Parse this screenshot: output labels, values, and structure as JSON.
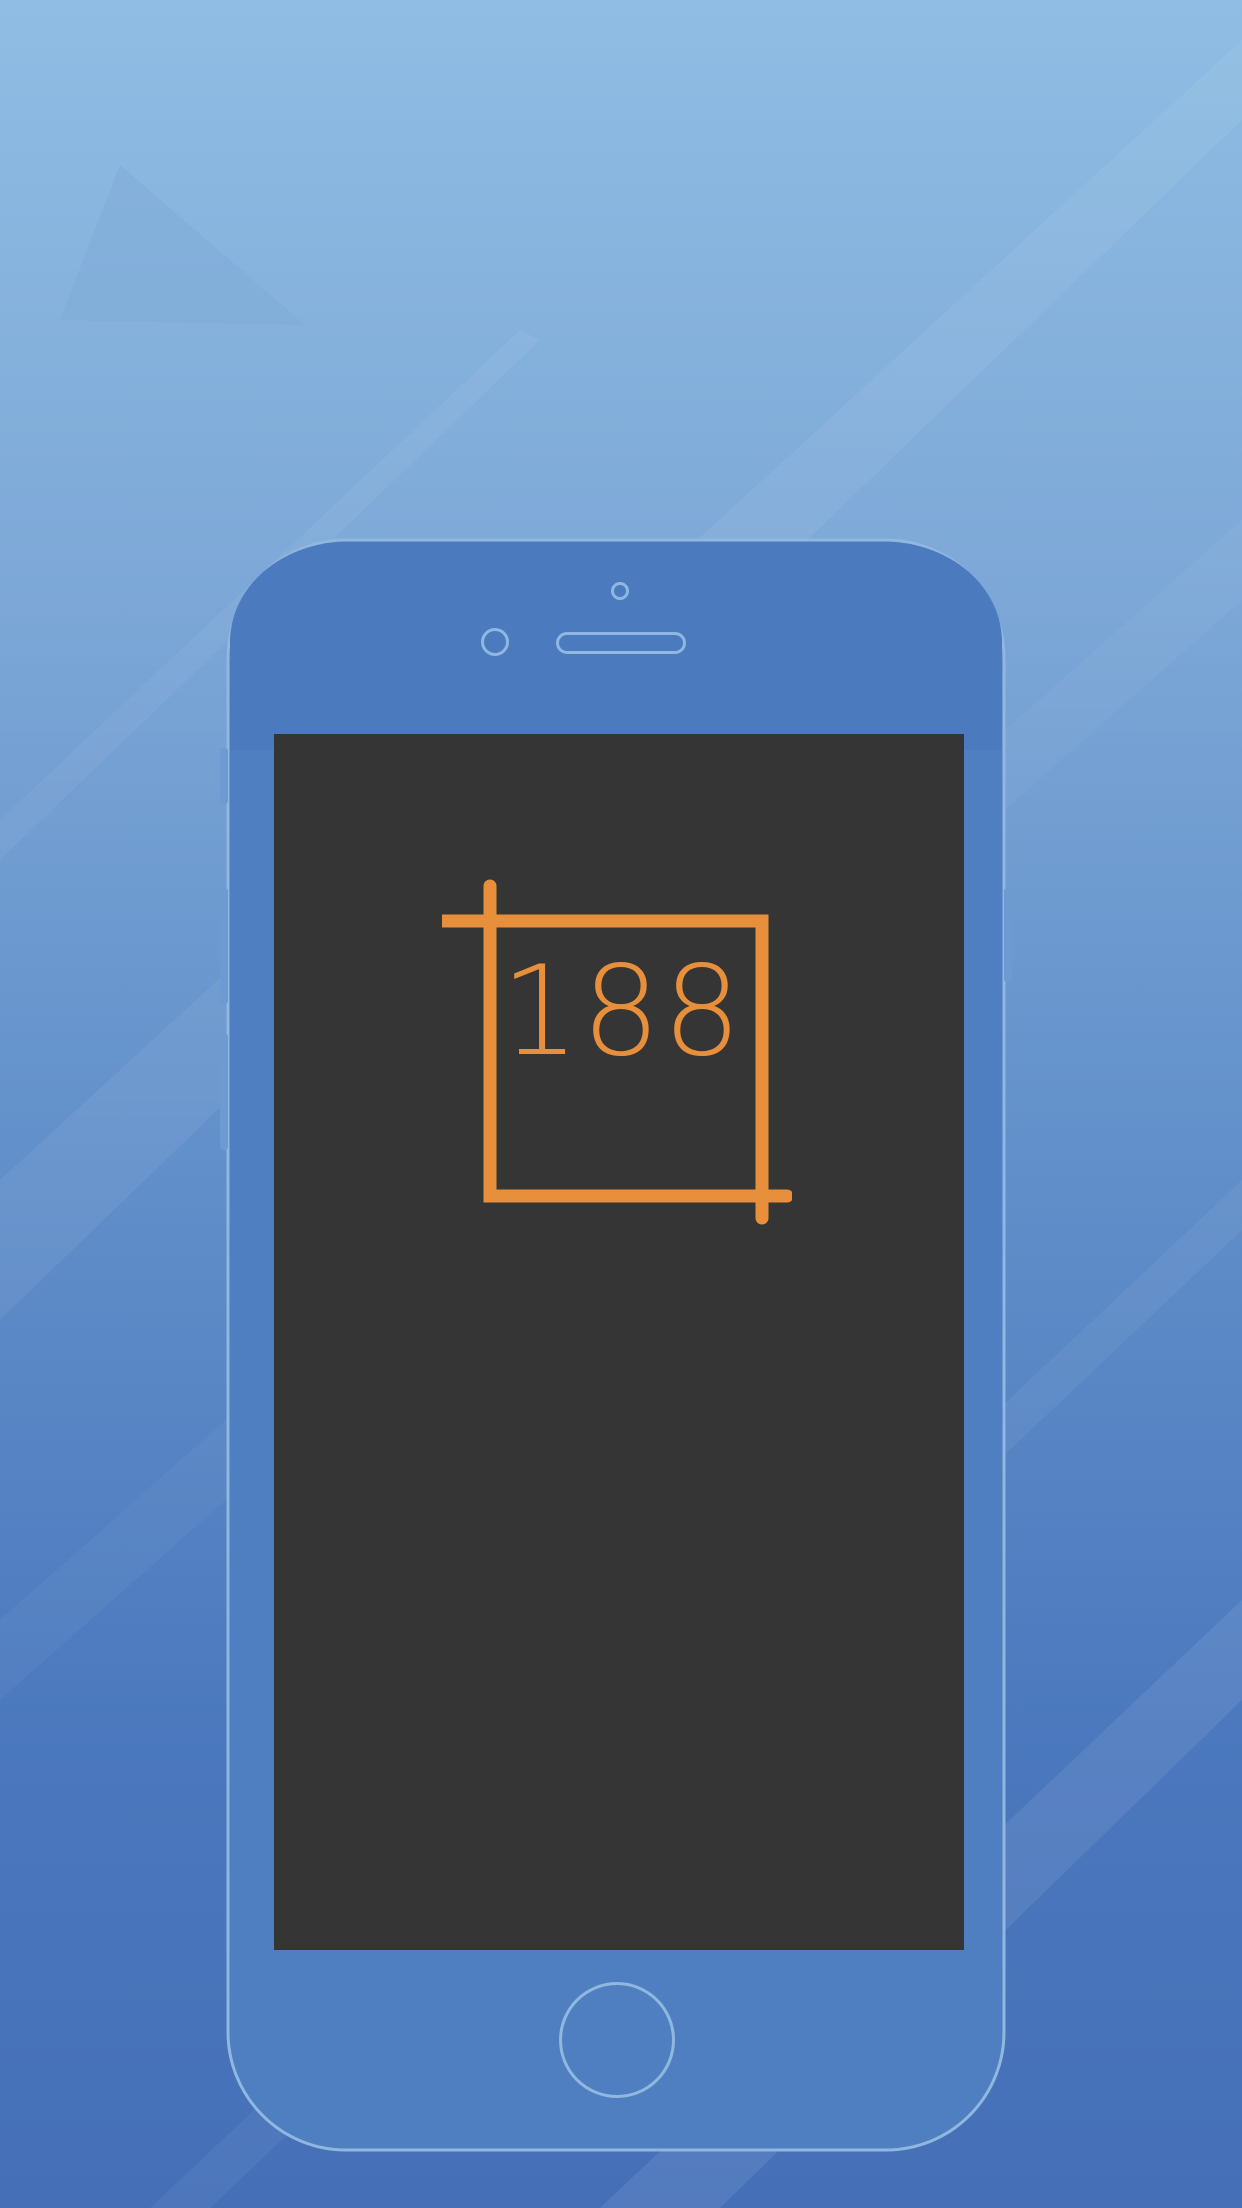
{
  "background": {
    "gradient_top": "#8fbde3",
    "gradient_bottom": "#4570b8"
  },
  "phone": {
    "body_color": "#4f7fc0",
    "outline_color": "#8fb7e0",
    "screen_color": "#353535"
  },
  "app_logo": {
    "number": "188",
    "color": "#e78f3b",
    "icon": "crop-icon"
  }
}
